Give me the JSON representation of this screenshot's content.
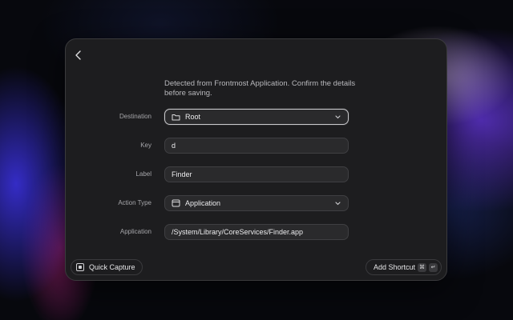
{
  "form": {
    "description": "Detected from Frontmost Application. Confirm the details before saving.",
    "destination": {
      "label": "Destination",
      "value": "Root",
      "icon": "folder-icon"
    },
    "key": {
      "label": "Key",
      "value": "d"
    },
    "label_field": {
      "label": "Label",
      "value": "Finder"
    },
    "action_type": {
      "label": "Action Type",
      "value": "Application",
      "icon": "app-window-icon"
    },
    "application": {
      "label": "Application",
      "value": "/System/Library/CoreServices/Finder.app"
    }
  },
  "footer": {
    "quick_capture": "Quick Capture",
    "add_shortcut": "Add Shortcut",
    "keys": [
      "⌘",
      "↵"
    ]
  },
  "colors": {
    "panel_bg": "#1d1d1f",
    "field_bg": "#2a2a2c",
    "focus_border": "#c9c9cc"
  }
}
